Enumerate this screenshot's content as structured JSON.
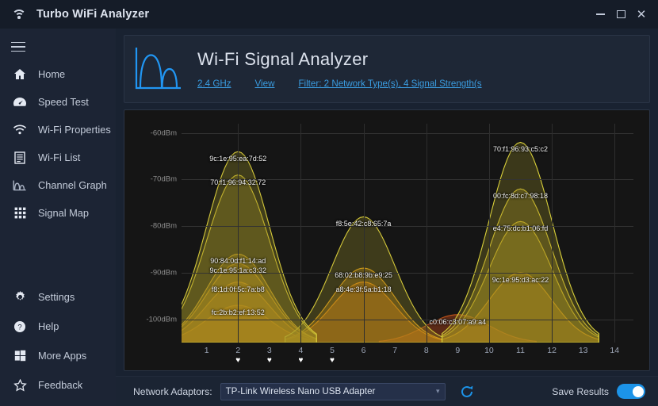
{
  "window": {
    "title": "Turbo WiFi Analyzer",
    "icon": "wifi-icon",
    "minimize": "–",
    "maximize": "▭",
    "close": "✕"
  },
  "sidebar": {
    "menu_icon": "hamburger-icon",
    "items": [
      {
        "label": "Home",
        "icon": "home-icon"
      },
      {
        "label": "Speed Test",
        "icon": "speedometer-icon"
      },
      {
        "label": "Wi-Fi Properties",
        "icon": "wifi-icon"
      },
      {
        "label": "Wi-Fi List",
        "icon": "list-icon"
      },
      {
        "label": "Channel Graph",
        "icon": "chart-icon"
      },
      {
        "label": "Signal Map",
        "icon": "grid-icon"
      }
    ],
    "bottom_items": [
      {
        "label": "Settings",
        "icon": "gear-icon"
      },
      {
        "label": "Help",
        "icon": "question-icon"
      },
      {
        "label": "More Apps",
        "icon": "windows-icon"
      },
      {
        "label": "Feedback",
        "icon": "star-icon"
      }
    ]
  },
  "header": {
    "logo": "signal-chart-icon",
    "title": "Wi-Fi Signal Analyzer",
    "links": [
      {
        "label": "2.4 GHz",
        "name": "band-link"
      },
      {
        "label": "View",
        "name": "view-link"
      },
      {
        "label": "Filter: 2 Network Type(s), 4 Signal Strength(s",
        "name": "filter-link"
      }
    ],
    "link_color": "#3a9ce0"
  },
  "bottom_bar": {
    "adaptor_label": "Network Adaptors:",
    "adapter_value": "TP-Link Wireless Nano USB Adapter",
    "adapter_caret": "▾",
    "refresh_icon": "refresh-icon",
    "save_label": "Save Results",
    "save_enabled": true,
    "toggle_color": "#1c93e8"
  },
  "chart_data": {
    "type": "area",
    "title": "Wi-Fi Signal Analyzer",
    "xlabel": "",
    "ylabel": "",
    "grid": true,
    "legend": "inline-labels",
    "xlim": [
      0.2,
      14.6
    ],
    "ylim": [
      -105,
      -58
    ],
    "y_ticks": [
      -60,
      -70,
      -80,
      -90,
      -100
    ],
    "y_tick_labels": [
      "-60dBm",
      "-70dBm",
      "-80dBm",
      "-90dBm",
      "-100dBm"
    ],
    "x_ticks": [
      1,
      2,
      3,
      4,
      5,
      6,
      7,
      8,
      9,
      10,
      11,
      12,
      13,
      14
    ],
    "x_tick_labels": [
      "1",
      "2",
      "3",
      "4",
      "5",
      "6",
      "7",
      "8",
      "9",
      "10",
      "11",
      "12",
      "13",
      "14"
    ],
    "favorite_channels": [
      2,
      3,
      4,
      5
    ],
    "favorite_icon": "heart-icon",
    "networks": [
      {
        "bssid": "9c:1e:95:ea:7d:52",
        "channel": 2,
        "signal_dbm": -64,
        "color": "#d4c83a",
        "fill": "rgba(150,140,40,0.34)"
      },
      {
        "bssid": "70:f1:96:94:32:72",
        "channel": 2,
        "signal_dbm": -69,
        "color": "#d8c430",
        "fill": "rgba(160,145,35,0.34)"
      },
      {
        "bssid": "90:84:0d:f1:14:ad",
        "channel": 2,
        "signal_dbm": -86,
        "color": "#e0a81f",
        "fill": "rgba(190,140,25,0.36)"
      },
      {
        "bssid": "9c:1e:95:1a:c3:32",
        "channel": 2,
        "signal_dbm": -88,
        "color": "#e8a016",
        "fill": "rgba(200,135,20,0.36)"
      },
      {
        "bssid": "f8:1d:0f:5c:7a:b8",
        "channel": 2,
        "signal_dbm": -92,
        "color": "#ef9410",
        "fill": "rgba(215,125,15,0.38)"
      },
      {
        "bssid": "fc:2b:b2:ef:13:52",
        "channel": 2,
        "signal_dbm": -97,
        "color": "#f2890c",
        "fill": "rgba(225,115,10,0.42)"
      },
      {
        "bssid": "f8:5e:42:c8:65:7a",
        "channel": 6,
        "signal_dbm": -78,
        "color": "#d4c83a",
        "fill": "rgba(150,140,40,0.32)"
      },
      {
        "bssid": "68:02:b8:9b:e9:25",
        "channel": 6,
        "signal_dbm": -89,
        "color": "#e8a016",
        "fill": "rgba(200,135,20,0.36)"
      },
      {
        "bssid": "a8:4e:3f:5a:b1:18",
        "channel": 6,
        "signal_dbm": -92,
        "color": "#f2890c",
        "fill": "rgba(225,115,10,0.40)"
      },
      {
        "bssid": "c0:06:c3:07:a9:a4",
        "channel": 9,
        "signal_dbm": -99,
        "color": "#c2541a",
        "fill": "rgba(150,60,25,0.55)"
      },
      {
        "bssid": "70:f1:96:93:c5:c2",
        "channel": 11,
        "signal_dbm": -62,
        "color": "#d8cf3a",
        "fill": "rgba(150,140,40,0.30)"
      },
      {
        "bssid": "00:fc:8d:c7:98:18",
        "channel": 11,
        "signal_dbm": -72,
        "color": "#dcc832",
        "fill": "rgba(170,150,35,0.32)"
      },
      {
        "bssid": "e4:75:dc:b1:06:fd",
        "channel": 11,
        "signal_dbm": -79,
        "color": "#e0c228",
        "fill": "rgba(185,160,30,0.34)"
      },
      {
        "bssid": "9c:1e:95:d3:ac:22",
        "channel": 11,
        "signal_dbm": -90,
        "color": "#ef9410",
        "fill": "rgba(215,125,15,0.36)"
      }
    ]
  }
}
